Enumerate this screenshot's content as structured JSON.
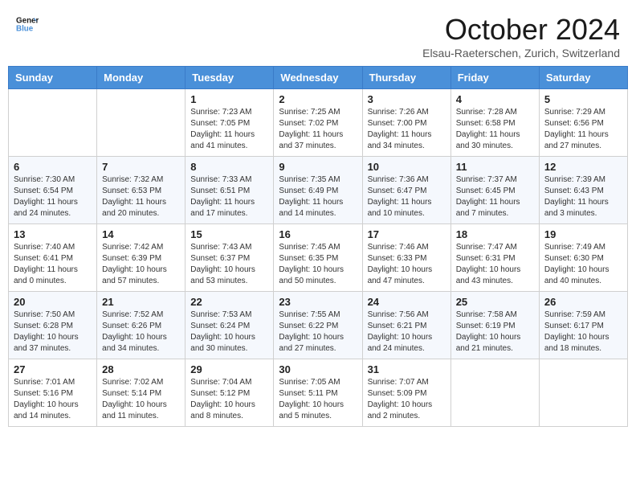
{
  "header": {
    "logo_line1": "General",
    "logo_line2": "Blue",
    "month_year": "October 2024",
    "location": "Elsau-Raeterschen, Zurich, Switzerland"
  },
  "days_of_week": [
    "Sunday",
    "Monday",
    "Tuesday",
    "Wednesday",
    "Thursday",
    "Friday",
    "Saturday"
  ],
  "weeks": [
    [
      {
        "day": "",
        "info": ""
      },
      {
        "day": "",
        "info": ""
      },
      {
        "day": "1",
        "info": "Sunrise: 7:23 AM\nSunset: 7:05 PM\nDaylight: 11 hours and 41 minutes."
      },
      {
        "day": "2",
        "info": "Sunrise: 7:25 AM\nSunset: 7:02 PM\nDaylight: 11 hours and 37 minutes."
      },
      {
        "day": "3",
        "info": "Sunrise: 7:26 AM\nSunset: 7:00 PM\nDaylight: 11 hours and 34 minutes."
      },
      {
        "day": "4",
        "info": "Sunrise: 7:28 AM\nSunset: 6:58 PM\nDaylight: 11 hours and 30 minutes."
      },
      {
        "day": "5",
        "info": "Sunrise: 7:29 AM\nSunset: 6:56 PM\nDaylight: 11 hours and 27 minutes."
      }
    ],
    [
      {
        "day": "6",
        "info": "Sunrise: 7:30 AM\nSunset: 6:54 PM\nDaylight: 11 hours and 24 minutes."
      },
      {
        "day": "7",
        "info": "Sunrise: 7:32 AM\nSunset: 6:53 PM\nDaylight: 11 hours and 20 minutes."
      },
      {
        "day": "8",
        "info": "Sunrise: 7:33 AM\nSunset: 6:51 PM\nDaylight: 11 hours and 17 minutes."
      },
      {
        "day": "9",
        "info": "Sunrise: 7:35 AM\nSunset: 6:49 PM\nDaylight: 11 hours and 14 minutes."
      },
      {
        "day": "10",
        "info": "Sunrise: 7:36 AM\nSunset: 6:47 PM\nDaylight: 11 hours and 10 minutes."
      },
      {
        "day": "11",
        "info": "Sunrise: 7:37 AM\nSunset: 6:45 PM\nDaylight: 11 hours and 7 minutes."
      },
      {
        "day": "12",
        "info": "Sunrise: 7:39 AM\nSunset: 6:43 PM\nDaylight: 11 hours and 3 minutes."
      }
    ],
    [
      {
        "day": "13",
        "info": "Sunrise: 7:40 AM\nSunset: 6:41 PM\nDaylight: 11 hours and 0 minutes."
      },
      {
        "day": "14",
        "info": "Sunrise: 7:42 AM\nSunset: 6:39 PM\nDaylight: 10 hours and 57 minutes."
      },
      {
        "day": "15",
        "info": "Sunrise: 7:43 AM\nSunset: 6:37 PM\nDaylight: 10 hours and 53 minutes."
      },
      {
        "day": "16",
        "info": "Sunrise: 7:45 AM\nSunset: 6:35 PM\nDaylight: 10 hours and 50 minutes."
      },
      {
        "day": "17",
        "info": "Sunrise: 7:46 AM\nSunset: 6:33 PM\nDaylight: 10 hours and 47 minutes."
      },
      {
        "day": "18",
        "info": "Sunrise: 7:47 AM\nSunset: 6:31 PM\nDaylight: 10 hours and 43 minutes."
      },
      {
        "day": "19",
        "info": "Sunrise: 7:49 AM\nSunset: 6:30 PM\nDaylight: 10 hours and 40 minutes."
      }
    ],
    [
      {
        "day": "20",
        "info": "Sunrise: 7:50 AM\nSunset: 6:28 PM\nDaylight: 10 hours and 37 minutes."
      },
      {
        "day": "21",
        "info": "Sunrise: 7:52 AM\nSunset: 6:26 PM\nDaylight: 10 hours and 34 minutes."
      },
      {
        "day": "22",
        "info": "Sunrise: 7:53 AM\nSunset: 6:24 PM\nDaylight: 10 hours and 30 minutes."
      },
      {
        "day": "23",
        "info": "Sunrise: 7:55 AM\nSunset: 6:22 PM\nDaylight: 10 hours and 27 minutes."
      },
      {
        "day": "24",
        "info": "Sunrise: 7:56 AM\nSunset: 6:21 PM\nDaylight: 10 hours and 24 minutes."
      },
      {
        "day": "25",
        "info": "Sunrise: 7:58 AM\nSunset: 6:19 PM\nDaylight: 10 hours and 21 minutes."
      },
      {
        "day": "26",
        "info": "Sunrise: 7:59 AM\nSunset: 6:17 PM\nDaylight: 10 hours and 18 minutes."
      }
    ],
    [
      {
        "day": "27",
        "info": "Sunrise: 7:01 AM\nSunset: 5:16 PM\nDaylight: 10 hours and 14 minutes."
      },
      {
        "day": "28",
        "info": "Sunrise: 7:02 AM\nSunset: 5:14 PM\nDaylight: 10 hours and 11 minutes."
      },
      {
        "day": "29",
        "info": "Sunrise: 7:04 AM\nSunset: 5:12 PM\nDaylight: 10 hours and 8 minutes."
      },
      {
        "day": "30",
        "info": "Sunrise: 7:05 AM\nSunset: 5:11 PM\nDaylight: 10 hours and 5 minutes."
      },
      {
        "day": "31",
        "info": "Sunrise: 7:07 AM\nSunset: 5:09 PM\nDaylight: 10 hours and 2 minutes."
      },
      {
        "day": "",
        "info": ""
      },
      {
        "day": "",
        "info": ""
      }
    ]
  ]
}
